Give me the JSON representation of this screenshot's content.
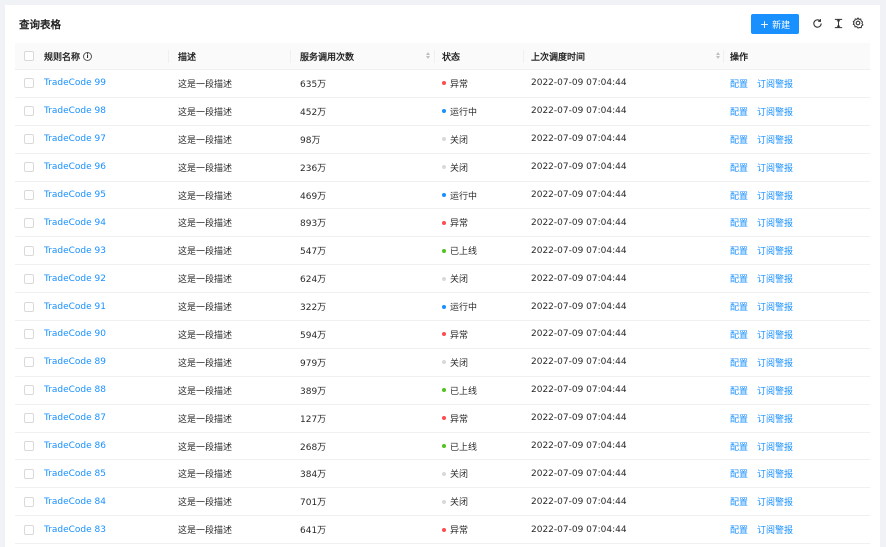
{
  "title": "查询表格",
  "toolbar": {
    "new_label": "新建",
    "plus_glyph": "+"
  },
  "icons": {
    "reload": "reload-icon",
    "density": "column-height-icon",
    "settings": "setting-icon"
  },
  "colors": {
    "primary": "#1890ff",
    "error": "#ff4d4f",
    "processing": "#1890ff",
    "success": "#52c41a",
    "default": "#d9d9d9"
  },
  "columns": {
    "name": "规则名称",
    "desc": "描述",
    "calls": "服务调用次数",
    "status": "状态",
    "time": "上次调度时间",
    "ops": "操作"
  },
  "rows": [
    {
      "name": "TradeCode 99",
      "desc": "这是一段描述",
      "calls": "635万",
      "status": "异常",
      "status_type": "error",
      "time": "2022-07-09 07:04:44",
      "op1": "配置",
      "op2": "订阅警报"
    },
    {
      "name": "TradeCode 98",
      "desc": "这是一段描述",
      "calls": "452万",
      "status": "运行中",
      "status_type": "processing",
      "time": "2022-07-09 07:04:44",
      "op1": "配置",
      "op2": "订阅警报"
    },
    {
      "name": "TradeCode 97",
      "desc": "这是一段描述",
      "calls": "98万",
      "status": "关闭",
      "status_type": "default",
      "time": "2022-07-09 07:04:44",
      "op1": "配置",
      "op2": "订阅警报"
    },
    {
      "name": "TradeCode 96",
      "desc": "这是一段描述",
      "calls": "236万",
      "status": "关闭",
      "status_type": "default",
      "time": "2022-07-09 07:04:44",
      "op1": "配置",
      "op2": "订阅警报"
    },
    {
      "name": "TradeCode 95",
      "desc": "这是一段描述",
      "calls": "469万",
      "status": "运行中",
      "status_type": "processing",
      "time": "2022-07-09 07:04:44",
      "op1": "配置",
      "op2": "订阅警报"
    },
    {
      "name": "TradeCode 94",
      "desc": "这是一段描述",
      "calls": "893万",
      "status": "异常",
      "status_type": "error",
      "time": "2022-07-09 07:04:44",
      "op1": "配置",
      "op2": "订阅警报"
    },
    {
      "name": "TradeCode 93",
      "desc": "这是一段描述",
      "calls": "547万",
      "status": "已上线",
      "status_type": "success",
      "time": "2022-07-09 07:04:44",
      "op1": "配置",
      "op2": "订阅警报"
    },
    {
      "name": "TradeCode 92",
      "desc": "这是一段描述",
      "calls": "624万",
      "status": "关闭",
      "status_type": "default",
      "time": "2022-07-09 07:04:44",
      "op1": "配置",
      "op2": "订阅警报"
    },
    {
      "name": "TradeCode 91",
      "desc": "这是一段描述",
      "calls": "322万",
      "status": "运行中",
      "status_type": "processing",
      "time": "2022-07-09 07:04:44",
      "op1": "配置",
      "op2": "订阅警报"
    },
    {
      "name": "TradeCode 90",
      "desc": "这是一段描述",
      "calls": "594万",
      "status": "异常",
      "status_type": "error",
      "time": "2022-07-09 07:04:44",
      "op1": "配置",
      "op2": "订阅警报"
    },
    {
      "name": "TradeCode 89",
      "desc": "这是一段描述",
      "calls": "979万",
      "status": "关闭",
      "status_type": "default",
      "time": "2022-07-09 07:04:44",
      "op1": "配置",
      "op2": "订阅警报"
    },
    {
      "name": "TradeCode 88",
      "desc": "这是一段描述",
      "calls": "389万",
      "status": "已上线",
      "status_type": "success",
      "time": "2022-07-09 07:04:44",
      "op1": "配置",
      "op2": "订阅警报"
    },
    {
      "name": "TradeCode 87",
      "desc": "这是一段描述",
      "calls": "127万",
      "status": "异常",
      "status_type": "error",
      "time": "2022-07-09 07:04:44",
      "op1": "配置",
      "op2": "订阅警报"
    },
    {
      "name": "TradeCode 86",
      "desc": "这是一段描述",
      "calls": "268万",
      "status": "已上线",
      "status_type": "success",
      "time": "2022-07-09 07:04:44",
      "op1": "配置",
      "op2": "订阅警报"
    },
    {
      "name": "TradeCode 85",
      "desc": "这是一段描述",
      "calls": "384万",
      "status": "关闭",
      "status_type": "default",
      "time": "2022-07-09 07:04:44",
      "op1": "配置",
      "op2": "订阅警报"
    },
    {
      "name": "TradeCode 84",
      "desc": "这是一段描述",
      "calls": "701万",
      "status": "关闭",
      "status_type": "default",
      "time": "2022-07-09 07:04:44",
      "op1": "配置",
      "op2": "订阅警报"
    },
    {
      "name": "TradeCode 83",
      "desc": "这是一段描述",
      "calls": "641万",
      "status": "异常",
      "status_type": "error",
      "time": "2022-07-09 07:04:44",
      "op1": "配置",
      "op2": "订阅警报"
    }
  ]
}
